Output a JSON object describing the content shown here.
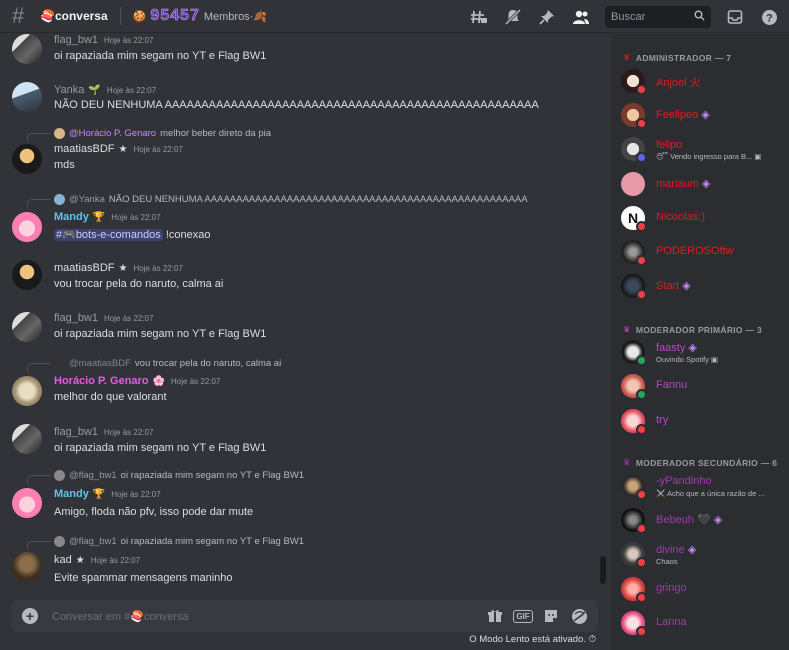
{
  "header": {
    "channel_name": "🍣conversa",
    "topic_prefix": "🍪",
    "member_count": "95457",
    "topic_suffix": "Membros·🍂",
    "search_placeholder": "Buscar"
  },
  "messages": [
    {
      "user": "flag_bw1",
      "time": "Hoje às 22:07",
      "text": "oi rapaziada mim segam no YT e Flag BW1",
      "color": "#949ba4"
    },
    {
      "user": "Yanka",
      "badge": "🌱",
      "time": "Hoje às 22:07",
      "text": "NÃO DEU NENHUMA AAAAAAAAAAAAAAAAAAAAAAAAAAAAAAAAAAAAAAAAAAAAAAAAAAA",
      "color": "#949ba4"
    },
    {
      "reply_user": "@Horácio P. Genaro",
      "reply_text": "melhor beber direto da pia",
      "user": "maatiasBDF",
      "badge": "★",
      "time": "Hoje às 22:07",
      "text": "mds",
      "color": "#dbdee1"
    },
    {
      "reply_user": "@Yanka",
      "reply_text": "NÃO DEU NENHUMA AAAAAAAAAAAAAAAAAAAAAAAAAAAAAAAAAAAAAAAAAAAAAAAAAAA",
      "user": "Mandy",
      "badge": "🏆",
      "time": "Hoje às 22:07",
      "mention": "#🎮bots-e-comandos",
      "text": "!conexao",
      "color": "#5bc8e8"
    },
    {
      "user": "maatiasBDF",
      "badge": "★",
      "time": "Hoje às 22:07",
      "text": "vou trocar pela do naruto, calma ai",
      "color": "#dbdee1"
    },
    {
      "user": "flag_bw1",
      "time": "Hoje às 22:07",
      "text": "oi rapaziada mim segam no YT e Flag BW1",
      "color": "#949ba4"
    },
    {
      "reply_user": "@maatiasBDF",
      "reply_text": "vou trocar pela do naruto, calma ai",
      "user": "Horácio P. Genaro",
      "badge": "🌸",
      "time": "Hoje às 22:07",
      "text": "melhor do que valorant",
      "color": "#eb59e8"
    },
    {
      "user": "flag_bw1",
      "time": "Hoje às 22:07",
      "text": "oi rapaziada mim segam no YT e Flag BW1",
      "color": "#949ba4"
    },
    {
      "reply_user": "@flag_bw1",
      "reply_text": "oi rapaziada mim segam no YT e Flag BW1",
      "user": "Mandy",
      "badge": "🏆",
      "time": "Hoje às 22:07",
      "text": "Amigo, floda não pfv, isso pode dar mute",
      "color": "#5bc8e8"
    },
    {
      "reply_user": "@flag_bw1",
      "reply_text": "oi rapaziada mim segam no YT e Flag BW1",
      "user": "kad",
      "badge": "★",
      "time": "Hoje às 22:07",
      "text": "Evite spammar mensagens maninho",
      "color": "#dbdee1"
    }
  ],
  "member_groups": [
    {
      "title": "ADMINISTRADOR — 7",
      "members": [
        {
          "name": "Anjoel 火",
          "color": "#e01b24"
        },
        {
          "name": "Feelipeo",
          "color": "#e01b24",
          "extra": "◈"
        },
        {
          "name": "felipo",
          "color": "#e01b24",
          "status": "😴 Vendo ingresso para B..."
        },
        {
          "name": "mariaum",
          "color": "#e01b24",
          "extra": "◈"
        },
        {
          "name": "Nicoolas;)",
          "color": "#e01b24"
        },
        {
          "name": "PODEROSOftw",
          "color": "#e01b24"
        },
        {
          "name": "Start",
          "color": "#e01b24",
          "extra": "◈"
        }
      ]
    },
    {
      "title": "MODERADOR PRIMÁRIO — 3",
      "members": [
        {
          "name": "faasty",
          "color": "#b847c9",
          "extra": "◈",
          "status": "Ouvindo Spotify"
        },
        {
          "name": "Fannu",
          "color": "#b847c9"
        },
        {
          "name": "try",
          "color": "#b847c9"
        }
      ]
    },
    {
      "title": "MODERADOR SECUNDÁRIO — 6",
      "members": [
        {
          "name": "-yPandinho",
          "color": "#a23ab0",
          "status": "⚔️ Acho que a única razão de ..."
        },
        {
          "name": "Bebeuh 🖤",
          "color": "#a23ab0",
          "extra": "◈"
        },
        {
          "name": "divine",
          "color": "#a23ab0",
          "extra": "◈",
          "status": "Chaos"
        },
        {
          "name": "gringo",
          "color": "#a23ab0"
        },
        {
          "name": "Lanna",
          "color": "#a23ab0"
        }
      ]
    }
  ],
  "composer": {
    "placeholder": "Conversar em #🍣conversa",
    "slowmode": "O Modo Lento está ativado."
  }
}
